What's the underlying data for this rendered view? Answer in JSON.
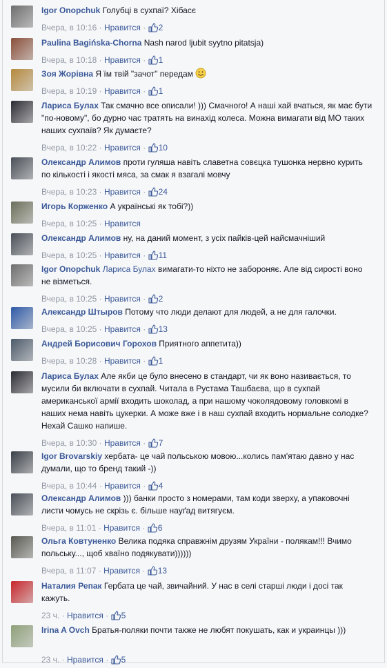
{
  "comments": [
    {
      "author": "Igor Onopchuk",
      "text": "Голубці в сухпаї? Хібасє",
      "time": "Вчера, в 10:16",
      "like_label": "Нравится",
      "likes": "2",
      "avatar_color": "#6e6e6e",
      "avatar_icon": "avatar-photo"
    },
    {
      "author": "Paulina Bagińska-Chorna",
      "text": "Nash narod ljubit syytno pitatsja)",
      "time": "Вчера, в 10:18",
      "like_label": "Нравится",
      "likes": "1",
      "avatar_color": "#8a4f3a",
      "avatar_icon": "avatar-photo"
    },
    {
      "author": "Зоя Жорівна",
      "text": "Я їм твій \"зачот\" передам",
      "time": "Вчера, в 10:19",
      "like_label": "Нравится",
      "likes": "1",
      "avatar_color": "#b5893c",
      "avatar_icon": "avatar-photo",
      "emoji": "smile-icon"
    },
    {
      "author": "Лариса Булах",
      "text": "Так смачно все описали! ))) Смачного! А наші хай вчаться, як має бути \"по-новому\", бо дурно час тратять на винахід колеса. Можна вимагати від МО таких наших сухпаїв? Як думаєте?",
      "time": "Вчера, в 10:22",
      "like_label": "Нравится",
      "likes": "10",
      "avatar_color": "#2b2b33",
      "avatar_icon": "avatar-photo"
    },
    {
      "author": "Олександр Алимов",
      "text": "проти гуляша навіть славетна совєцка тушонка нервно курить по кількості і якості мяса, за смак я взагалі мовчу",
      "time": "Вчера, в 10:23",
      "like_label": "Нравится",
      "likes": "24",
      "avatar_color": "#4a5058",
      "avatar_icon": "avatar-photo"
    },
    {
      "author": "Игорь Корженко",
      "text": "А українські як тобі?))",
      "time": "Вчера, в 10:25",
      "like_label": "Нравится",
      "likes": "",
      "avatar_color": "#6b6f5a",
      "avatar_icon": "avatar-photo"
    },
    {
      "author": "Олександр Алимов",
      "text": "ну, на даний момент, з усіх пайків-цей найсмачніший",
      "time": "Вчера, в 10:25",
      "like_label": "Нравится",
      "likes": "11",
      "avatar_color": "#4a5058",
      "avatar_icon": "avatar-photo"
    },
    {
      "author": "Igor Onopchuk",
      "mention": "Лариса Булах",
      "text": "вимагати-то ніхто не забороняє. Але від сирості воно не візметься.",
      "time": "Вчера, в 10:25",
      "like_label": "Нравится",
      "likes": "2",
      "avatar_color": "#6e6e6e",
      "avatar_icon": "avatar-photo"
    },
    {
      "author": "Александр Штыров",
      "text": "Потому что люди делают для людей, а не для галочки.",
      "time": "Вчера, в 10:25",
      "like_label": "Нравится",
      "likes": "13",
      "avatar_color": "#2f5aa8",
      "avatar_icon": "avatar-photo"
    },
    {
      "author": "Андрей Борисович Горохов",
      "text": "Приятного аппетита))",
      "time": "Вчера, в 10:28",
      "like_label": "Нравится",
      "likes": "1",
      "avatar_color": "#4c5a6a",
      "avatar_icon": "avatar-photo"
    },
    {
      "author": "Лариса Булах",
      "text": "Але якби це було внесено в стандарт, чи як воно називається, то мусили би включати в сухпай. Читала в Рустама Ташбаєва, що в сухпай американської армії входить шоколад, а при нашому чоколядовому головкомі в наших нема навіть цукерки. А може вже і в наш сухпай входить нормальне солодке? Нехай Сашко напише.",
      "time": "Вчера, в 10:30",
      "like_label": "Нравится",
      "likes": "7",
      "avatar_color": "#2b2b33",
      "avatar_icon": "avatar-photo"
    },
    {
      "author": "Igor Brovarskiy",
      "text": "хербата- це чай польською мовою...колись пам'ятаю давно у нас думали, що то бренд такий -))",
      "time": "Вчера, в 10:44",
      "like_label": "Нравится",
      "likes": "4",
      "avatar_color": "#3a3f47",
      "avatar_icon": "avatar-photo"
    },
    {
      "author": "Олександр Алимов",
      "text": "))) банки просто з номерами, там коди зверху, а упаковочні листи чомусь не скрізь є. більше науґад витягуєм.",
      "time": "Вчера, в 11:01",
      "like_label": "Нравится",
      "likes": "6",
      "avatar_color": "#4a5058",
      "avatar_icon": "avatar-photo"
    },
    {
      "author": "Ольга Ковтуненко",
      "text": "Велика подяка справжнім друзям України - полякам!!! Вчимо польську..., щоб хваїно подякувати))))))",
      "time": "Вчера, в 11:07",
      "like_label": "Нравится",
      "likes": "13",
      "avatar_color": "#5a5a52",
      "avatar_icon": "avatar-photo"
    },
    {
      "author": "Наталия Репак",
      "text": "Гербата це чай, звичайний. У нас в селі старші люди і досі так кажуть.",
      "time": "23 ч.",
      "like_label": "Нравится",
      "likes": "5",
      "avatar_color": "#c8262b",
      "avatar_icon": "avatar-photo"
    },
    {
      "author": "Irina A Ovch",
      "text": "Братья-поляки почти также не любят покушать, как и украинцы )))",
      "time": "23 ч.",
      "like_label": "Нравится",
      "likes": "5",
      "avatar_color": "#8fa07a",
      "avatar_icon": "avatar-photo"
    }
  ],
  "colors": {
    "author": "#3b5998",
    "meta": "#9197a3",
    "text": "#141823",
    "background": "#f6f7f9"
  }
}
